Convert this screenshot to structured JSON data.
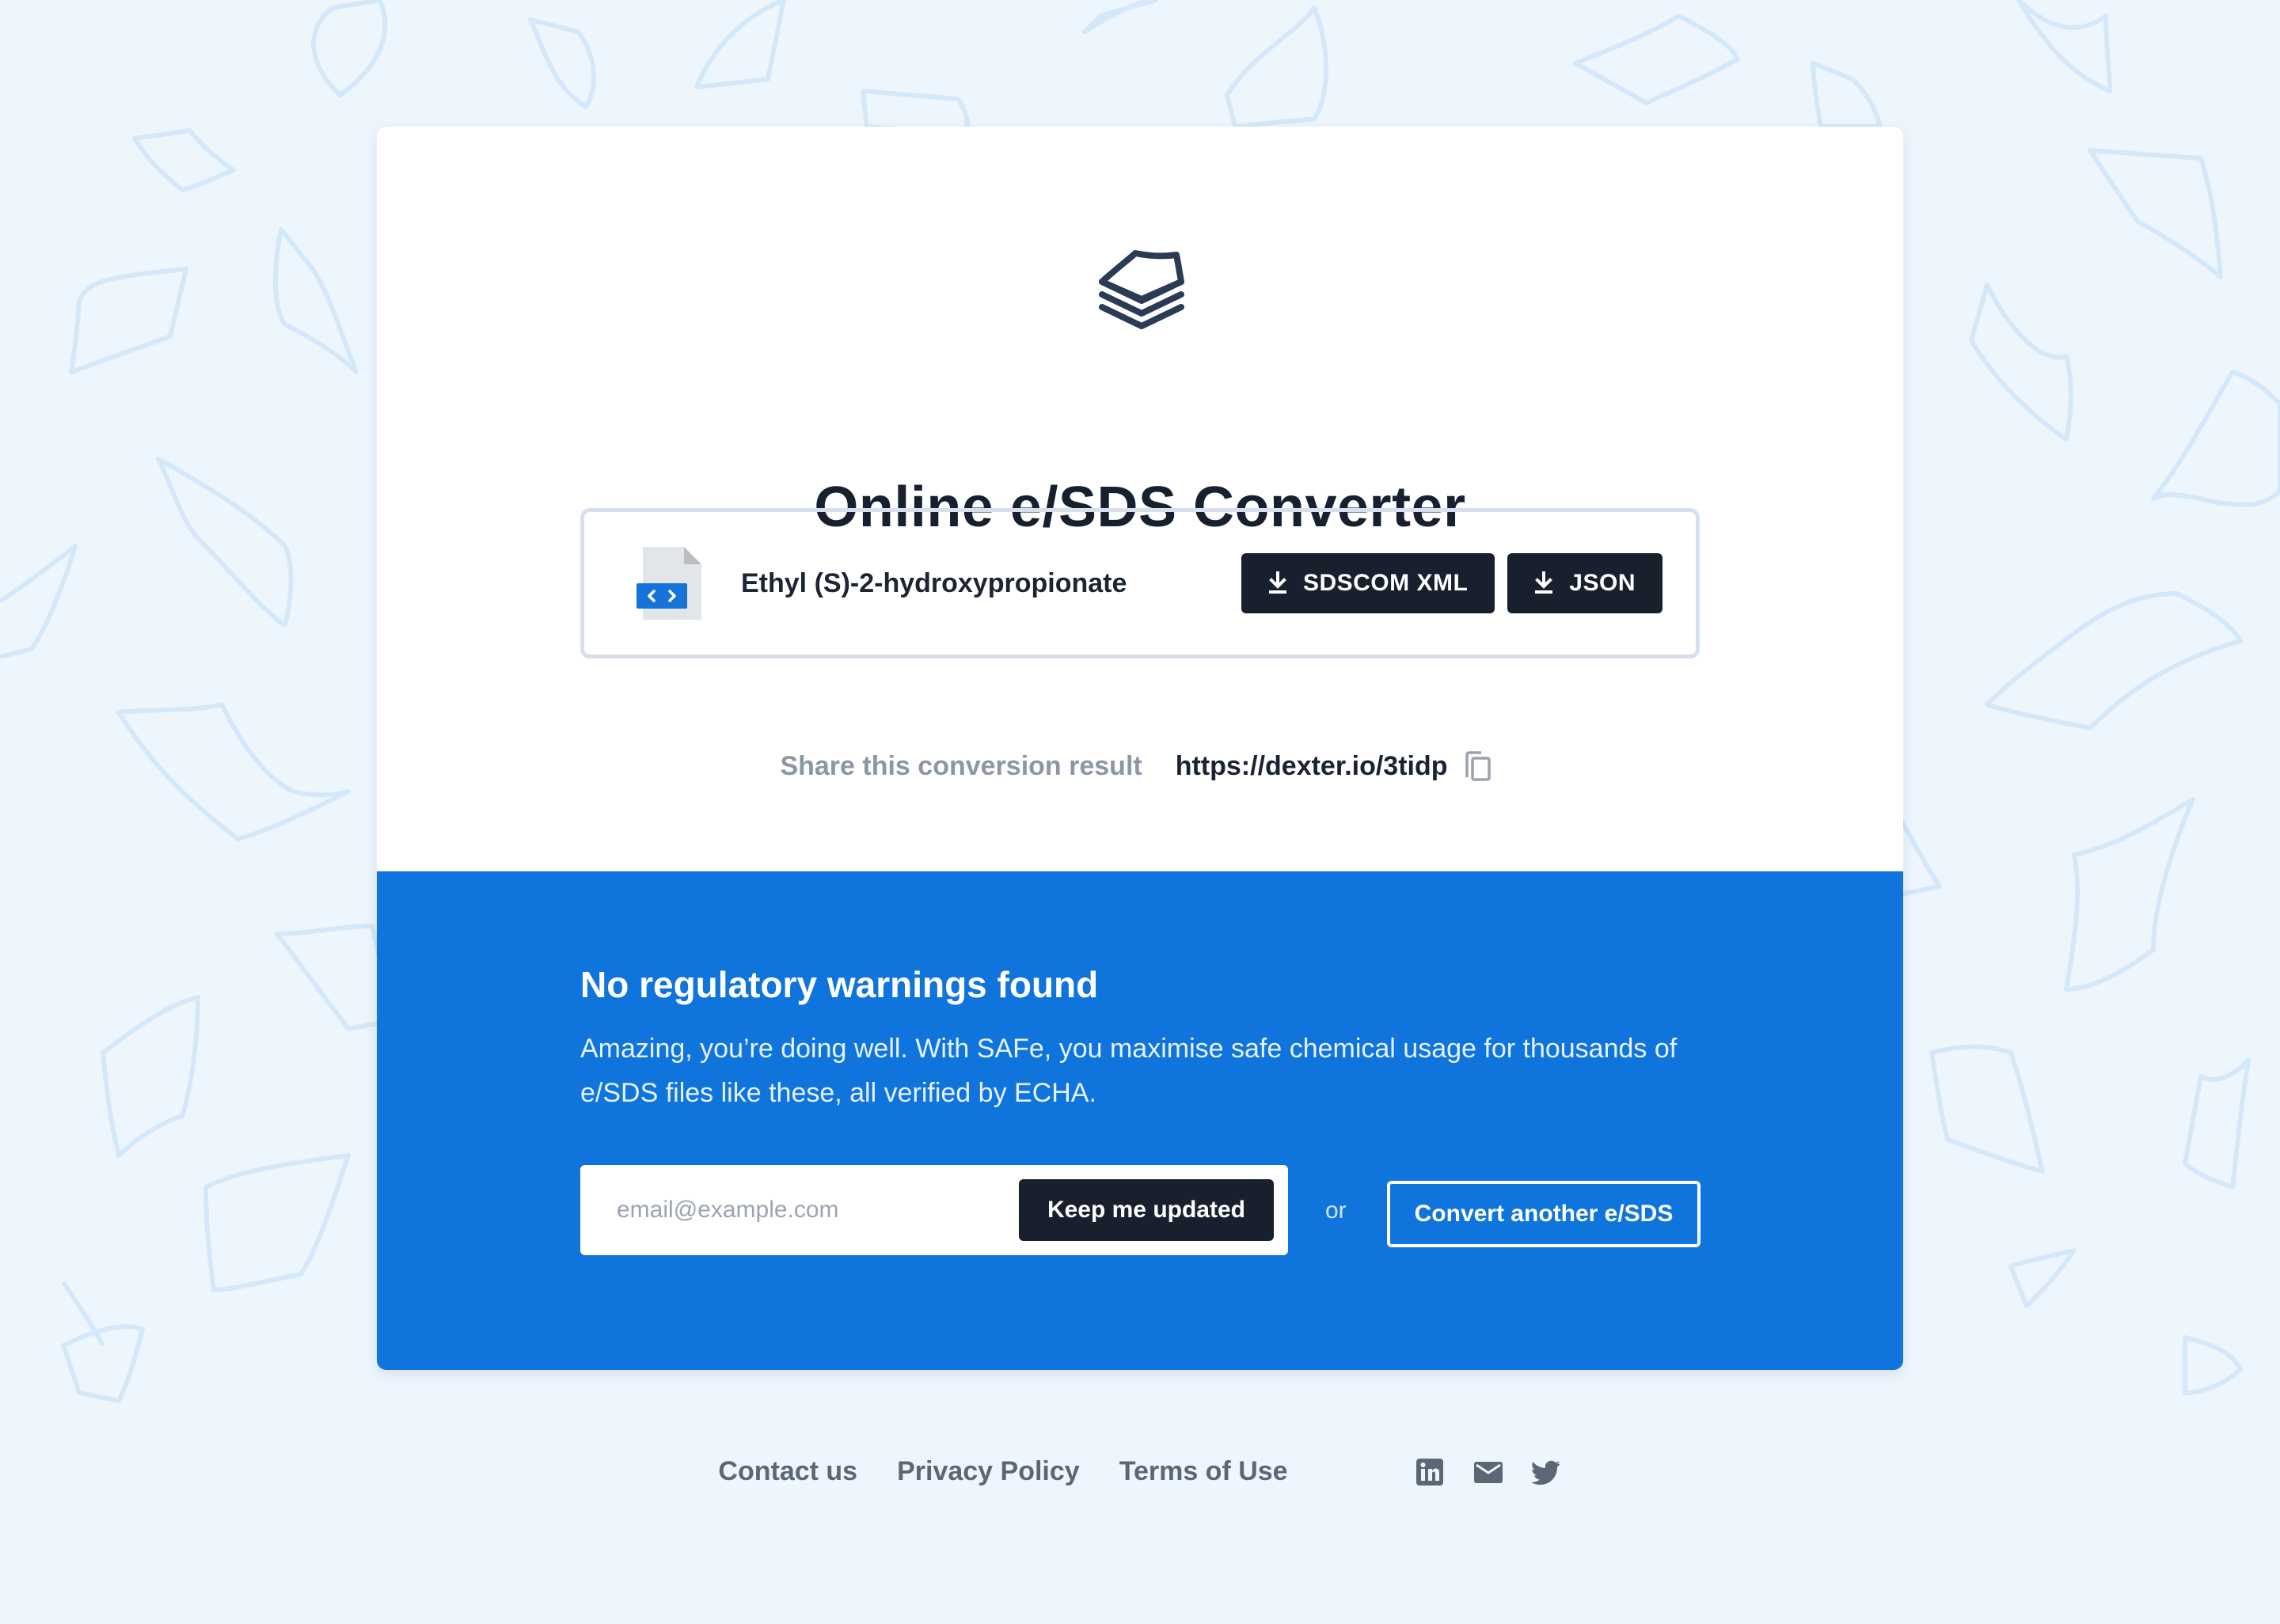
{
  "header": {
    "logo_icon": "layers-stack-icon",
    "title": "Online e/SDS Converter"
  },
  "file": {
    "icon": "code-file-icon",
    "name": "Ethyl (S)-2-hydroxypropionate",
    "downloads": [
      {
        "label": "SDSCOM XML",
        "icon": "download-icon"
      },
      {
        "label": "JSON",
        "icon": "download-icon"
      }
    ]
  },
  "share": {
    "label": "Share this conversion result",
    "url": "https://dexter.io/3tidp",
    "copy_icon": "copy-icon"
  },
  "result": {
    "heading": "No regulatory warnings found",
    "text": "Amazing, you’re doing well. With SAFe, you maximise safe chemical usage for thousands of e/SDS files like these, all verified by ECHA.",
    "email_placeholder": "email@example.com",
    "subscribe_label": "Keep me updated",
    "or_label": "or",
    "convert_label": "Convert another e/SDS"
  },
  "footer": {
    "links": [
      "Contact us",
      "Privacy Policy",
      "Terms of Use"
    ],
    "socials": [
      "linkedin-icon",
      "mail-icon",
      "twitter-icon"
    ]
  },
  "colors": {
    "background": "#eef6fd",
    "accent_blue": "#0f75dc",
    "dark_button": "#18202e",
    "title_text": "#17202f",
    "muted_text": "#8c96a4"
  }
}
